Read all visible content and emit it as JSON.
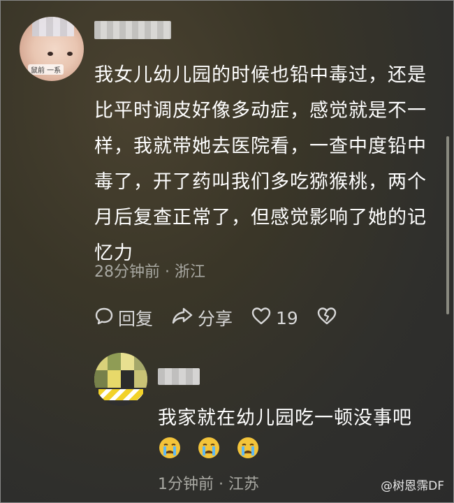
{
  "main_comment": {
    "avatar_caption": "鼠前 一系",
    "text": "我女儿幼儿园的时候也铅中毒过，还是比平时调皮好像多动症，感觉就是不一样，我就带她去医院看，一查中度铅中毒了，开了药叫我们多吃猕猴桃，两个月后复查正常了，但感觉影响了她的记忆力",
    "time": "28分钟前",
    "separator": "·",
    "location": "浙江",
    "actions": {
      "reply_label": "回复",
      "share_label": "分享",
      "like_count": "19"
    }
  },
  "reply_comment": {
    "text": "我家就在幼儿园吃一顿没事吧",
    "emojis": [
      "crying-face-icon",
      "crying-face-icon",
      "crying-face-icon"
    ],
    "time": "1分钟前",
    "separator": "·",
    "location": "江苏"
  },
  "watermark": {
    "text": "@树恩霈DF"
  },
  "colors": {
    "text": "#ffffff",
    "meta": "#a9a9a3",
    "action": "#d8d8d8",
    "emoji_face": "#f3c43a",
    "tear": "#5fb8f2"
  }
}
